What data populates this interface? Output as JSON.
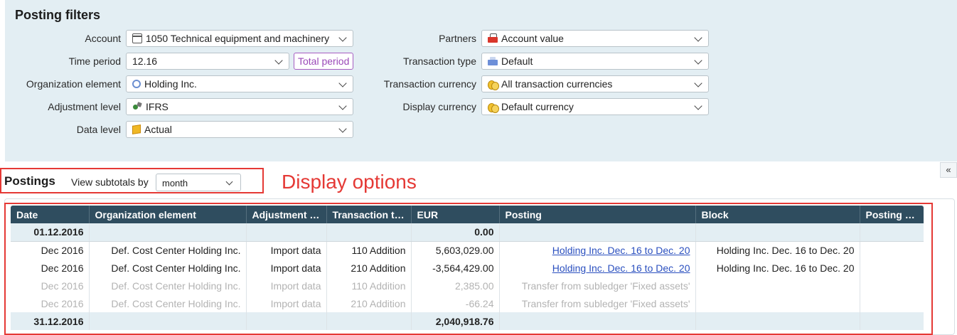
{
  "filters": {
    "title": "Posting filters",
    "left": [
      {
        "label": "Account",
        "value": "1050 Technical equipment and machinery",
        "icon": "calendar-icon"
      },
      {
        "label": "Time period",
        "value": "12.16",
        "button": "Total period"
      },
      {
        "label": "Organization element",
        "value": "Holding Inc.",
        "icon": "org-circle-icon"
      },
      {
        "label": "Adjustment level",
        "value": "IFRS",
        "icon": "adjustment-icon"
      },
      {
        "label": "Data level",
        "value": "Actual",
        "icon": "box-icon"
      }
    ],
    "right": [
      {
        "label": "Partners",
        "value": "Account value",
        "icon": "partner-icon"
      },
      {
        "label": "Transaction type",
        "value": "Default",
        "icon": "transaction-type-icon"
      },
      {
        "label": "Transaction currency",
        "value": "All transaction currencies",
        "icon": "coins-icon"
      },
      {
        "label": "Display currency",
        "value": "Default currency",
        "icon": "coins-icon"
      }
    ]
  },
  "postings": {
    "title": "Postings",
    "subtotal_label": "View subtotals by",
    "subtotal_value": "month",
    "annotation": "Display options",
    "collapse_glyph": "«"
  },
  "table": {
    "columns": [
      "Date",
      "Organization element",
      "Adjustment le...",
      "Transaction ty...",
      "EUR",
      "Posting",
      "Block",
      "Posting te..."
    ],
    "rows": [
      {
        "type": "sub",
        "cells": [
          "01.12.2016",
          "",
          "",
          "",
          "0.00",
          "",
          "",
          ""
        ]
      },
      {
        "type": "data",
        "cells": [
          "Dec 2016",
          "Def. Cost Center Holding Inc.",
          "Import data",
          "110 Addition",
          "5,603,029.00",
          "Holding Inc. Dec. 16 to Dec. 20",
          "Holding Inc. Dec. 16 to Dec. 20",
          ""
        ]
      },
      {
        "type": "data",
        "cells": [
          "Dec 2016",
          "Def. Cost Center Holding Inc.",
          "Import data",
          "210 Addition",
          "-3,564,429.00",
          "Holding Inc. Dec. 16 to Dec. 20",
          "Holding Inc. Dec. 16 to Dec. 20",
          ""
        ]
      },
      {
        "type": "dim",
        "cells": [
          "Dec 2016",
          "Def. Cost Center Holding Inc.",
          "Import data",
          "110 Addition",
          "2,385.00",
          "Transfer from subledger 'Fixed assets'",
          "",
          ""
        ]
      },
      {
        "type": "dim",
        "cells": [
          "Dec 2016",
          "Def. Cost Center Holding Inc.",
          "Import data",
          "210 Addition",
          "-66.24",
          "Transfer from subledger 'Fixed assets'",
          "",
          ""
        ]
      },
      {
        "type": "sub",
        "cells": [
          "31.12.2016",
          "",
          "",
          "",
          "2,040,918.76",
          "",
          "",
          ""
        ]
      }
    ]
  },
  "colors": {
    "filter_bg": "#e3eef3",
    "header_bg": "#2f4d5f",
    "annotation": "#e53935",
    "link": "#2a4fbf",
    "total_period": "#9b49b8"
  }
}
